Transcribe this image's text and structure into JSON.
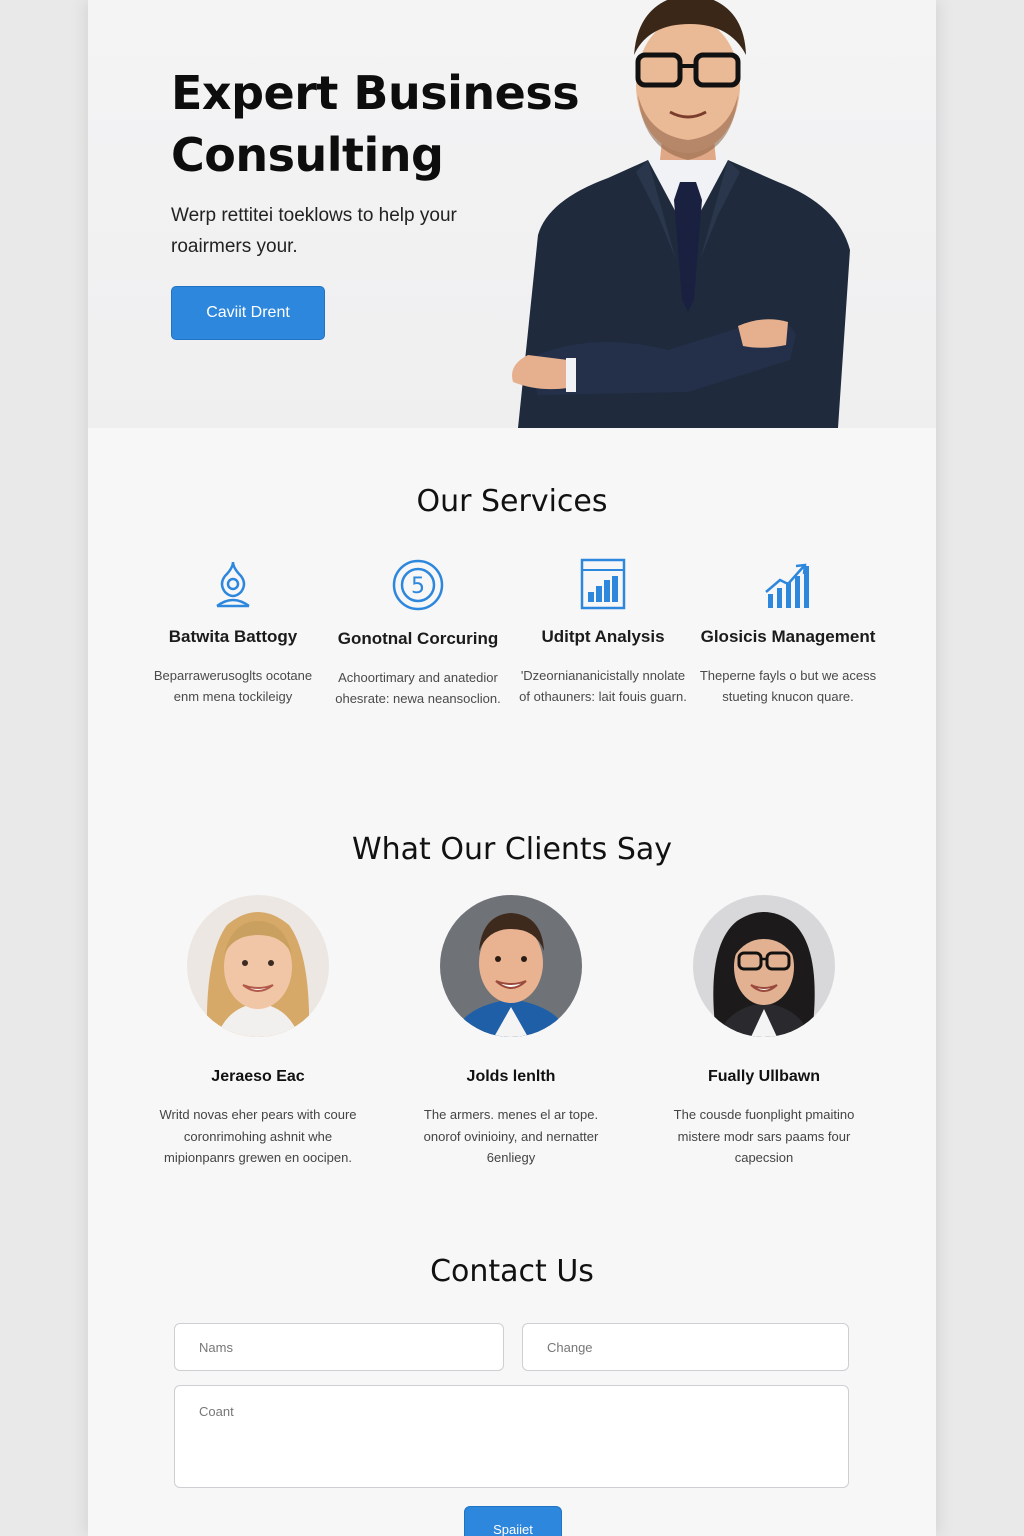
{
  "hero": {
    "title": "Expert Business Consulting",
    "subtitle": "Werp rettitei toeklows to help your roairmers your.",
    "cta_label": "Caviit Drent"
  },
  "services": {
    "title": "Our Services",
    "items": [
      {
        "name": "Batwita Battogy",
        "description": "Beparrawerusoglts ocotane enm mena tockileigy",
        "icon": "badge-icon"
      },
      {
        "name": "Gonotnal Corcuring",
        "description": "Achoortimary and anatedior ohesrate: newa neansoclion.",
        "icon": "target-icon"
      },
      {
        "name": "Uditpt Analysis",
        "description": "'Dzeorniananicistally nnolate of othauners: lait fouis guarn.",
        "icon": "bar-chart-icon"
      },
      {
        "name": "Glosicis Management",
        "description": "Theperne fayls o but we acess stueting knucon quare.",
        "icon": "growth-chart-icon"
      }
    ]
  },
  "testimonials": {
    "title": "What Our Clients Say",
    "items": [
      {
        "name": "Jeraeso Eac",
        "quote": "Writd novas eher pears with coure coronrimohing ashnit whe mipionpanrs grewen en oocipen."
      },
      {
        "name": "Jolds lenlth",
        "quote": "The armers. menes el ar tope. onorof ovinioiny, and nernatter 6enliegy"
      },
      {
        "name": "Fually Ullbawn",
        "quote": "The cousde fuonplight pmaitino mistere modr sars paams four capecsion"
      }
    ]
  },
  "contact": {
    "title": "Contact Us",
    "name_placeholder": "Nams",
    "second_placeholder": "Change",
    "message_placeholder": "Coant",
    "submit_label": "Spaiiet"
  },
  "colors": {
    "accent": "#2d87dd",
    "background": "#f7f7f8"
  }
}
